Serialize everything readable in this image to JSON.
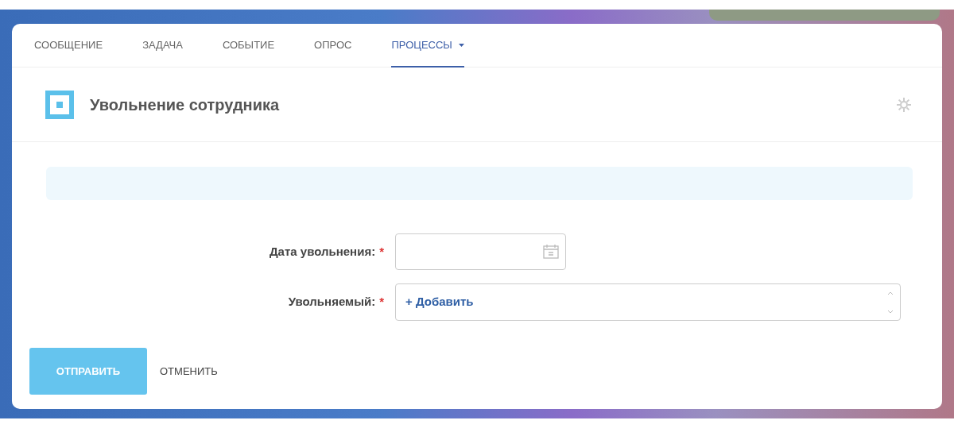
{
  "tabs": [
    {
      "label": "СООБЩЕНИЕ",
      "selected": false,
      "dropdown": false
    },
    {
      "label": "ЗАДАЧА",
      "selected": false,
      "dropdown": false
    },
    {
      "label": "СОБЫТИЕ",
      "selected": false,
      "dropdown": false
    },
    {
      "label": "ОПРОС",
      "selected": false,
      "dropdown": false
    },
    {
      "label": "ПРОЦЕССЫ",
      "selected": true,
      "dropdown": true
    }
  ],
  "header": {
    "title": "Увольнение сотрудника"
  },
  "form": {
    "fields": [
      {
        "kind": "date",
        "label": "Дата увольнения:",
        "required_mark": "*"
      },
      {
        "kind": "picker",
        "label": "Увольняемый:",
        "required_mark": "*",
        "add": "+ Добавить"
      }
    ]
  },
  "buttons": [
    {
      "kind": "primary",
      "label": "ОТПРАВИТЬ"
    },
    {
      "kind": "link",
      "label": "ОТМЕНИТЬ"
    }
  ]
}
